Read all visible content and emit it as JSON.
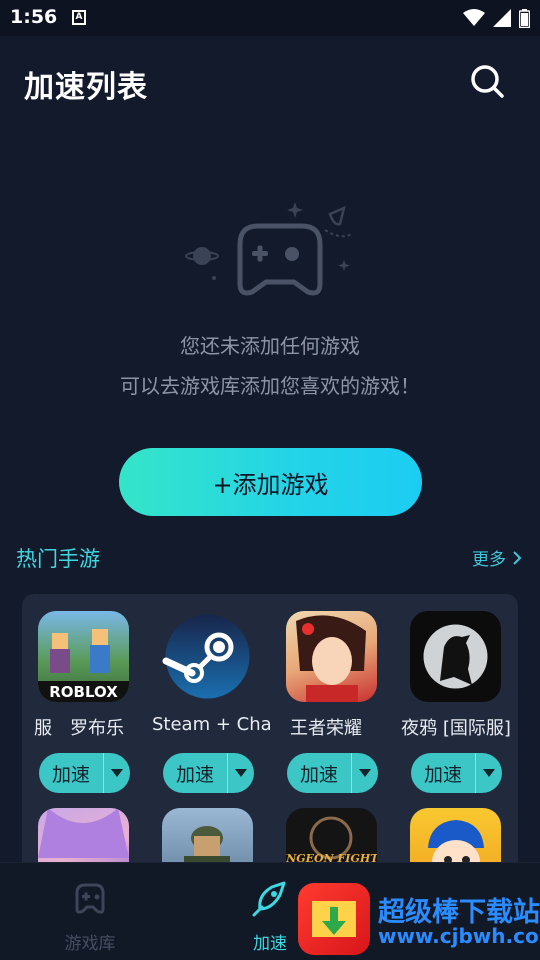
{
  "status_bar": {
    "time": "1:56",
    "a_icon": "A"
  },
  "header": {
    "title": "加速列表"
  },
  "empty_state": {
    "line1": "您还未添加任何游戏",
    "line2": "可以去游戏库添加您喜欢的游戏！"
  },
  "add_button": {
    "label": "+添加游戏"
  },
  "hot_section": {
    "title": "热门手游",
    "more_label": "更多",
    "games": [
      {
        "name": "服　罗布乐",
        "speed_label": "加速",
        "icon": "roblox-icon",
        "icon_text": "ROBLOX"
      },
      {
        "name": "Steam + Chat",
        "speed_label": "加速",
        "icon": "steam-icon"
      },
      {
        "name": "王者荣耀",
        "speed_label": "加速",
        "icon": "honor-of-kings-icon"
      },
      {
        "name": "夜鸦 [国际服]",
        "speed_label": "加速",
        "icon": "night-crows-icon"
      }
    ],
    "row2_icons": [
      {
        "icon": "anime-girl-game-icon"
      },
      {
        "icon": "pubg-icon"
      },
      {
        "icon": "dungeon-fighter-icon",
        "icon_text": "DUNGEON FIGHTER"
      },
      {
        "icon": "baseball-game-icon"
      }
    ]
  },
  "bottom_nav": {
    "items": [
      {
        "label": "游戏库",
        "icon": "gamepad-icon"
      },
      {
        "label": "加速",
        "icon": "rocket-icon"
      }
    ]
  },
  "watermark": {
    "title": "超级棒下载站",
    "url": "www.cjbwh.com"
  },
  "colors": {
    "background": "#131a2b",
    "accent": "#3fd8e0",
    "button_gradient_start": "#35e5c8",
    "button_gradient_end": "#1ccdf2"
  }
}
